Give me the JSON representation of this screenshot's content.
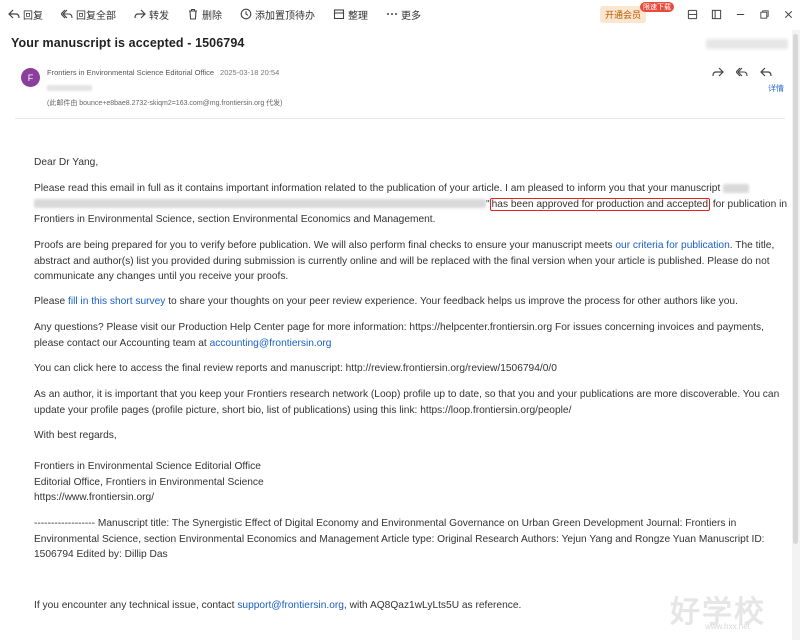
{
  "toolbar": {
    "reply": "回复",
    "reply_all": "回复全部",
    "forward": "转发",
    "delete": "删除",
    "pin_todo": "添加置顶待办",
    "organize": "整理",
    "more": "更多",
    "vip_label": "开通会员",
    "vip_tag": "限速下载"
  },
  "email": {
    "subject": "Your manuscript is accepted - 1506794",
    "avatar_letter": "F",
    "sender": "Frontiers in Environmental Science Editorial Office",
    "date": "2025-03-18 20:54",
    "proxy": "(此邮件由 bounce+e8bae8.2732-skiqm2=163.com@mg.frontiersin.org 代发)",
    "detail": "详情"
  },
  "body": {
    "greeting": "Dear Dr Yang,",
    "p1_l1": "Please read this email in full as it contains important information related to the publication of your article. I am pleased to inform you that your manuscript",
    "p1_l2_pre": "\"",
    "p1_l2_highlight": "has been approved for production and accepted",
    "p1_l2_post": " for publication in",
    "p1_l3": "Frontiers in Environmental Science, section Environmental Economics and Management.",
    "p2_l1_pre": "Proofs are being prepared for you to verify before publication. We will also perform final checks to ensure your manuscript meets ",
    "p2_l1_link": "our criteria for publication",
    "p2_l1_post": ". The title,",
    "p2_l2": "abstract and author(s) list you provided during submission is currently online and will be replaced with the final version when your article is published. Please do not",
    "p2_l3": "communicate any changes until you receive your proofs.",
    "p3_pre": "Please ",
    "p3_link": "fill in this short survey",
    "p3_post": " to share your thoughts on your peer review experience. Your feedback helps us improve the process for other authors like you.",
    "p4_l1": "Any questions? Please visit our Production Help Center page for more information: https://helpcenter.frontiersin.org For issues concerning invoices and payments,",
    "p4_l2_pre": "please contact our Accounting team at ",
    "p4_l2_link": "accounting@frontiersin.org",
    "p5": "You can click here to access the final review reports and manuscript: http://review.frontiersin.org/review/1506794/0/0",
    "p6_l1": "As an author, it is important that you keep your Frontiers research network (Loop) profile up to date, so that you and your publications are more discoverable. You can",
    "p6_l2": "update your profile pages (profile picture, short bio, list of publications) using this link: https://loop.frontiersin.org/people/",
    "regards": "With best regards,",
    "sig1": "Frontiers in Environmental Science Editorial Office",
    "sig2": "Editorial Office, Frontiers in Environmental Science",
    "sig3": "https://www.frontiersin.org/",
    "meta_l1": "------------------ Manuscript title: The Synergistic Effect of Digital Economy and Environmental Governance on Urban Green Development Journal: Frontiers in",
    "meta_l2": "Environmental Science, section Environmental Economics and Management Article type: Original Research Authors: Yejun Yang and Rongze Yuan Manuscript ID:",
    "meta_l3": "1506794 Edited by: Dillip Das",
    "support_pre": "If you encounter any technical issue, contact ",
    "support_link": "support@frontiersin.org",
    "support_post": ", with AQ8Qaz1wLyLts5U as reference."
  },
  "watermark": {
    "main": "好学校",
    "sub": "www.hxx.net"
  },
  "colors": {
    "link": "#1a5fc4",
    "highlight_border": "#e0231c",
    "avatar": "#8a3f9c"
  }
}
